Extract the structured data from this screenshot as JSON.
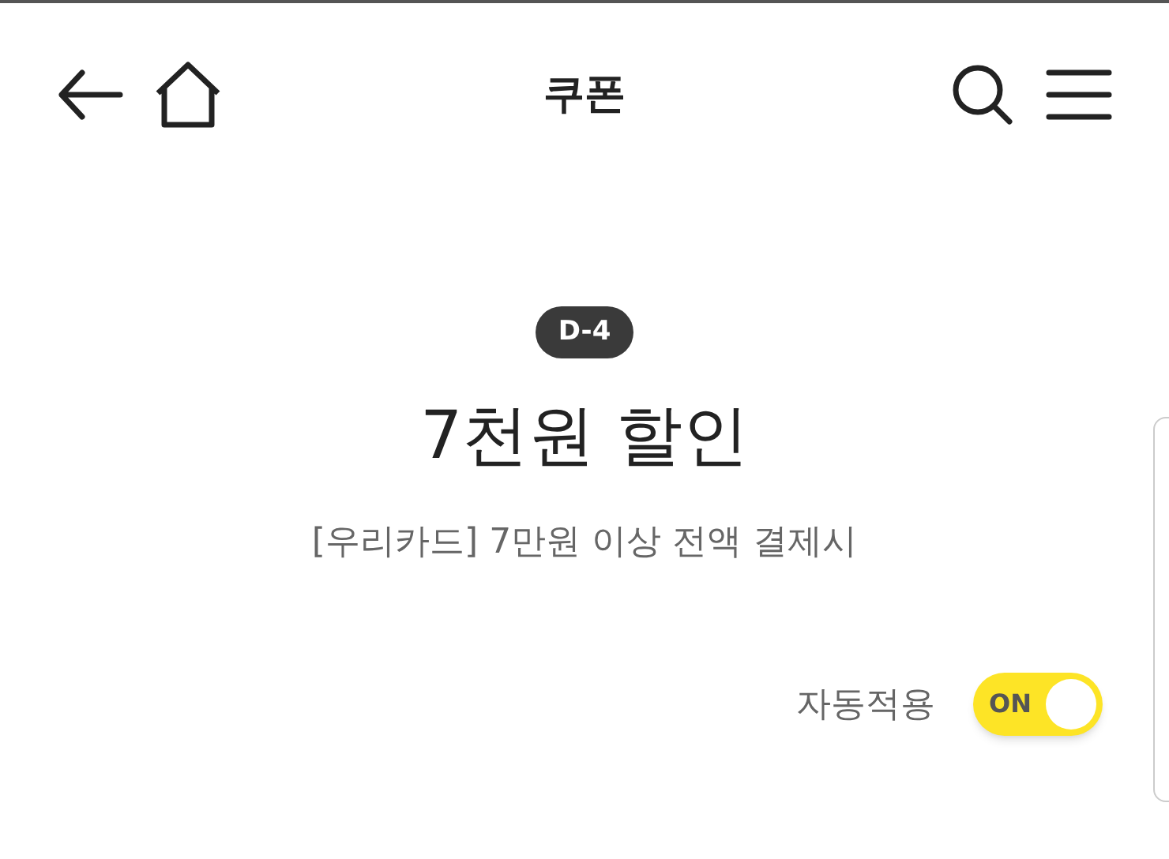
{
  "header": {
    "title": "쿠폰"
  },
  "coupon": {
    "badge": "D-4",
    "title": "7천원 할인",
    "condition": "[우리카드] 7만원 이상 전액 결제시"
  },
  "auto_apply": {
    "label": "자동적용",
    "toggle_text": "ON",
    "on": true
  }
}
